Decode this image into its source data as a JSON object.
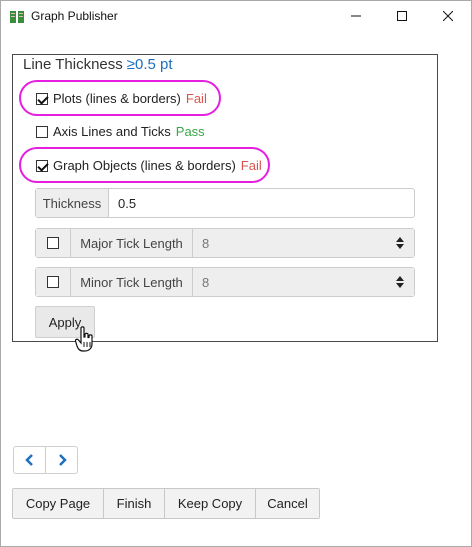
{
  "window": {
    "title": "Graph Publisher",
    "app_icon": "graph-publisher-icon",
    "controls": {
      "minimize": "minimize-icon",
      "maximize": "maximize-icon",
      "close": "close-icon"
    }
  },
  "group": {
    "legend": "Line Thickness",
    "criterion": "≥0.5 pt",
    "criterion_color": "#1f6fc0"
  },
  "checks": [
    {
      "label": "Plots (lines & borders)",
      "status": "Fail",
      "checked": true,
      "highlighted": true
    },
    {
      "label": "Axis Lines and Ticks",
      "status": "Pass",
      "checked": false,
      "highlighted": false
    },
    {
      "label": "Graph Objects (lines & borders)",
      "status": "Fail",
      "checked": true,
      "highlighted": true
    }
  ],
  "thickness": {
    "label": "Thickness",
    "value": "0.5"
  },
  "major_tick": {
    "label": "Major Tick Length",
    "value": "8",
    "checked": false
  },
  "minor_tick": {
    "label": "Minor Tick Length",
    "value": "8",
    "checked": false
  },
  "apply_label": "Apply",
  "nav": {
    "prev_icon": "chevron-left-icon",
    "next_icon": "chevron-right-icon"
  },
  "footer": {
    "copy_page": "Copy Page",
    "finish": "Finish",
    "keep_copy": "Keep Copy",
    "cancel": "Cancel"
  },
  "colors": {
    "fail": "#d9534f",
    "pass": "#3aa54a",
    "highlight": "#e61ee0",
    "nav_arrow": "#1f6fc0"
  }
}
